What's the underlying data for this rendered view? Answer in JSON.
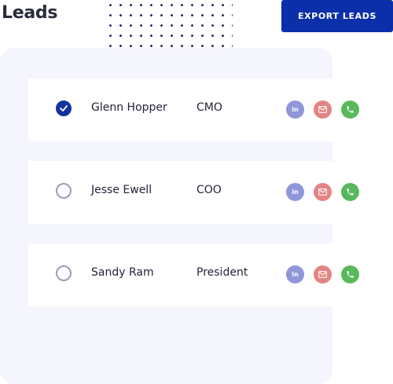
{
  "header": {
    "title": "Leads",
    "export_label": "EXPORT LEADS"
  },
  "leads": [
    {
      "name": "Glenn Hopper",
      "role": "CMO",
      "selected": true
    },
    {
      "name": "Jesse Ewell",
      "role": "COO",
      "selected": false
    },
    {
      "name": "Sandy Ram",
      "role": "President",
      "selected": false
    }
  ],
  "icons": {
    "linkedin": {
      "name": "linkedin-icon",
      "glyph": "in",
      "color": "#8f96da"
    },
    "mail": {
      "name": "mail-icon",
      "color": "#e38584"
    },
    "phone": {
      "name": "phone-icon",
      "color": "#58b85c"
    }
  },
  "colors": {
    "accent": "#0b2fa8",
    "panel_bg": "#f5f5fe",
    "checked": "#12339e",
    "unchecked_border": "#9a9db8"
  }
}
